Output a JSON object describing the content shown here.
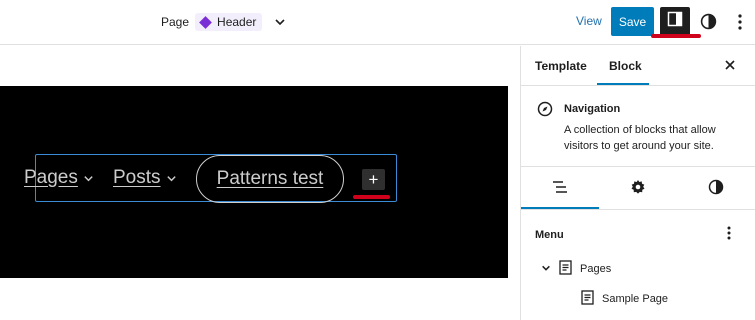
{
  "topbar": {
    "doc_type": "Page",
    "template_name": "Header",
    "view_label": "View",
    "save_label": "Save"
  },
  "canvas": {
    "nav_items": [
      {
        "label": "Pages",
        "has_submenu": true
      },
      {
        "label": "Posts",
        "has_submenu": true
      }
    ],
    "pill_label": "Patterns test",
    "add_label": "+"
  },
  "sidebar": {
    "tabs": [
      {
        "label": "Template",
        "active": false
      },
      {
        "label": "Block",
        "active": true
      }
    ],
    "block": {
      "title": "Navigation",
      "description": "A collection of blocks that allow visitors to get around your site."
    },
    "subtabs": [
      "list-view-icon",
      "gear-icon",
      "contrast-icon"
    ],
    "menu": {
      "title": "Menu",
      "items": [
        {
          "label": "Pages",
          "expanded": true
        },
        {
          "label": "Sample Page"
        }
      ]
    }
  },
  "colors": {
    "accent": "#007cba",
    "template_purple": "#7a2fd6",
    "annotation_red": "#d0021b",
    "header_bg": "#000000"
  }
}
